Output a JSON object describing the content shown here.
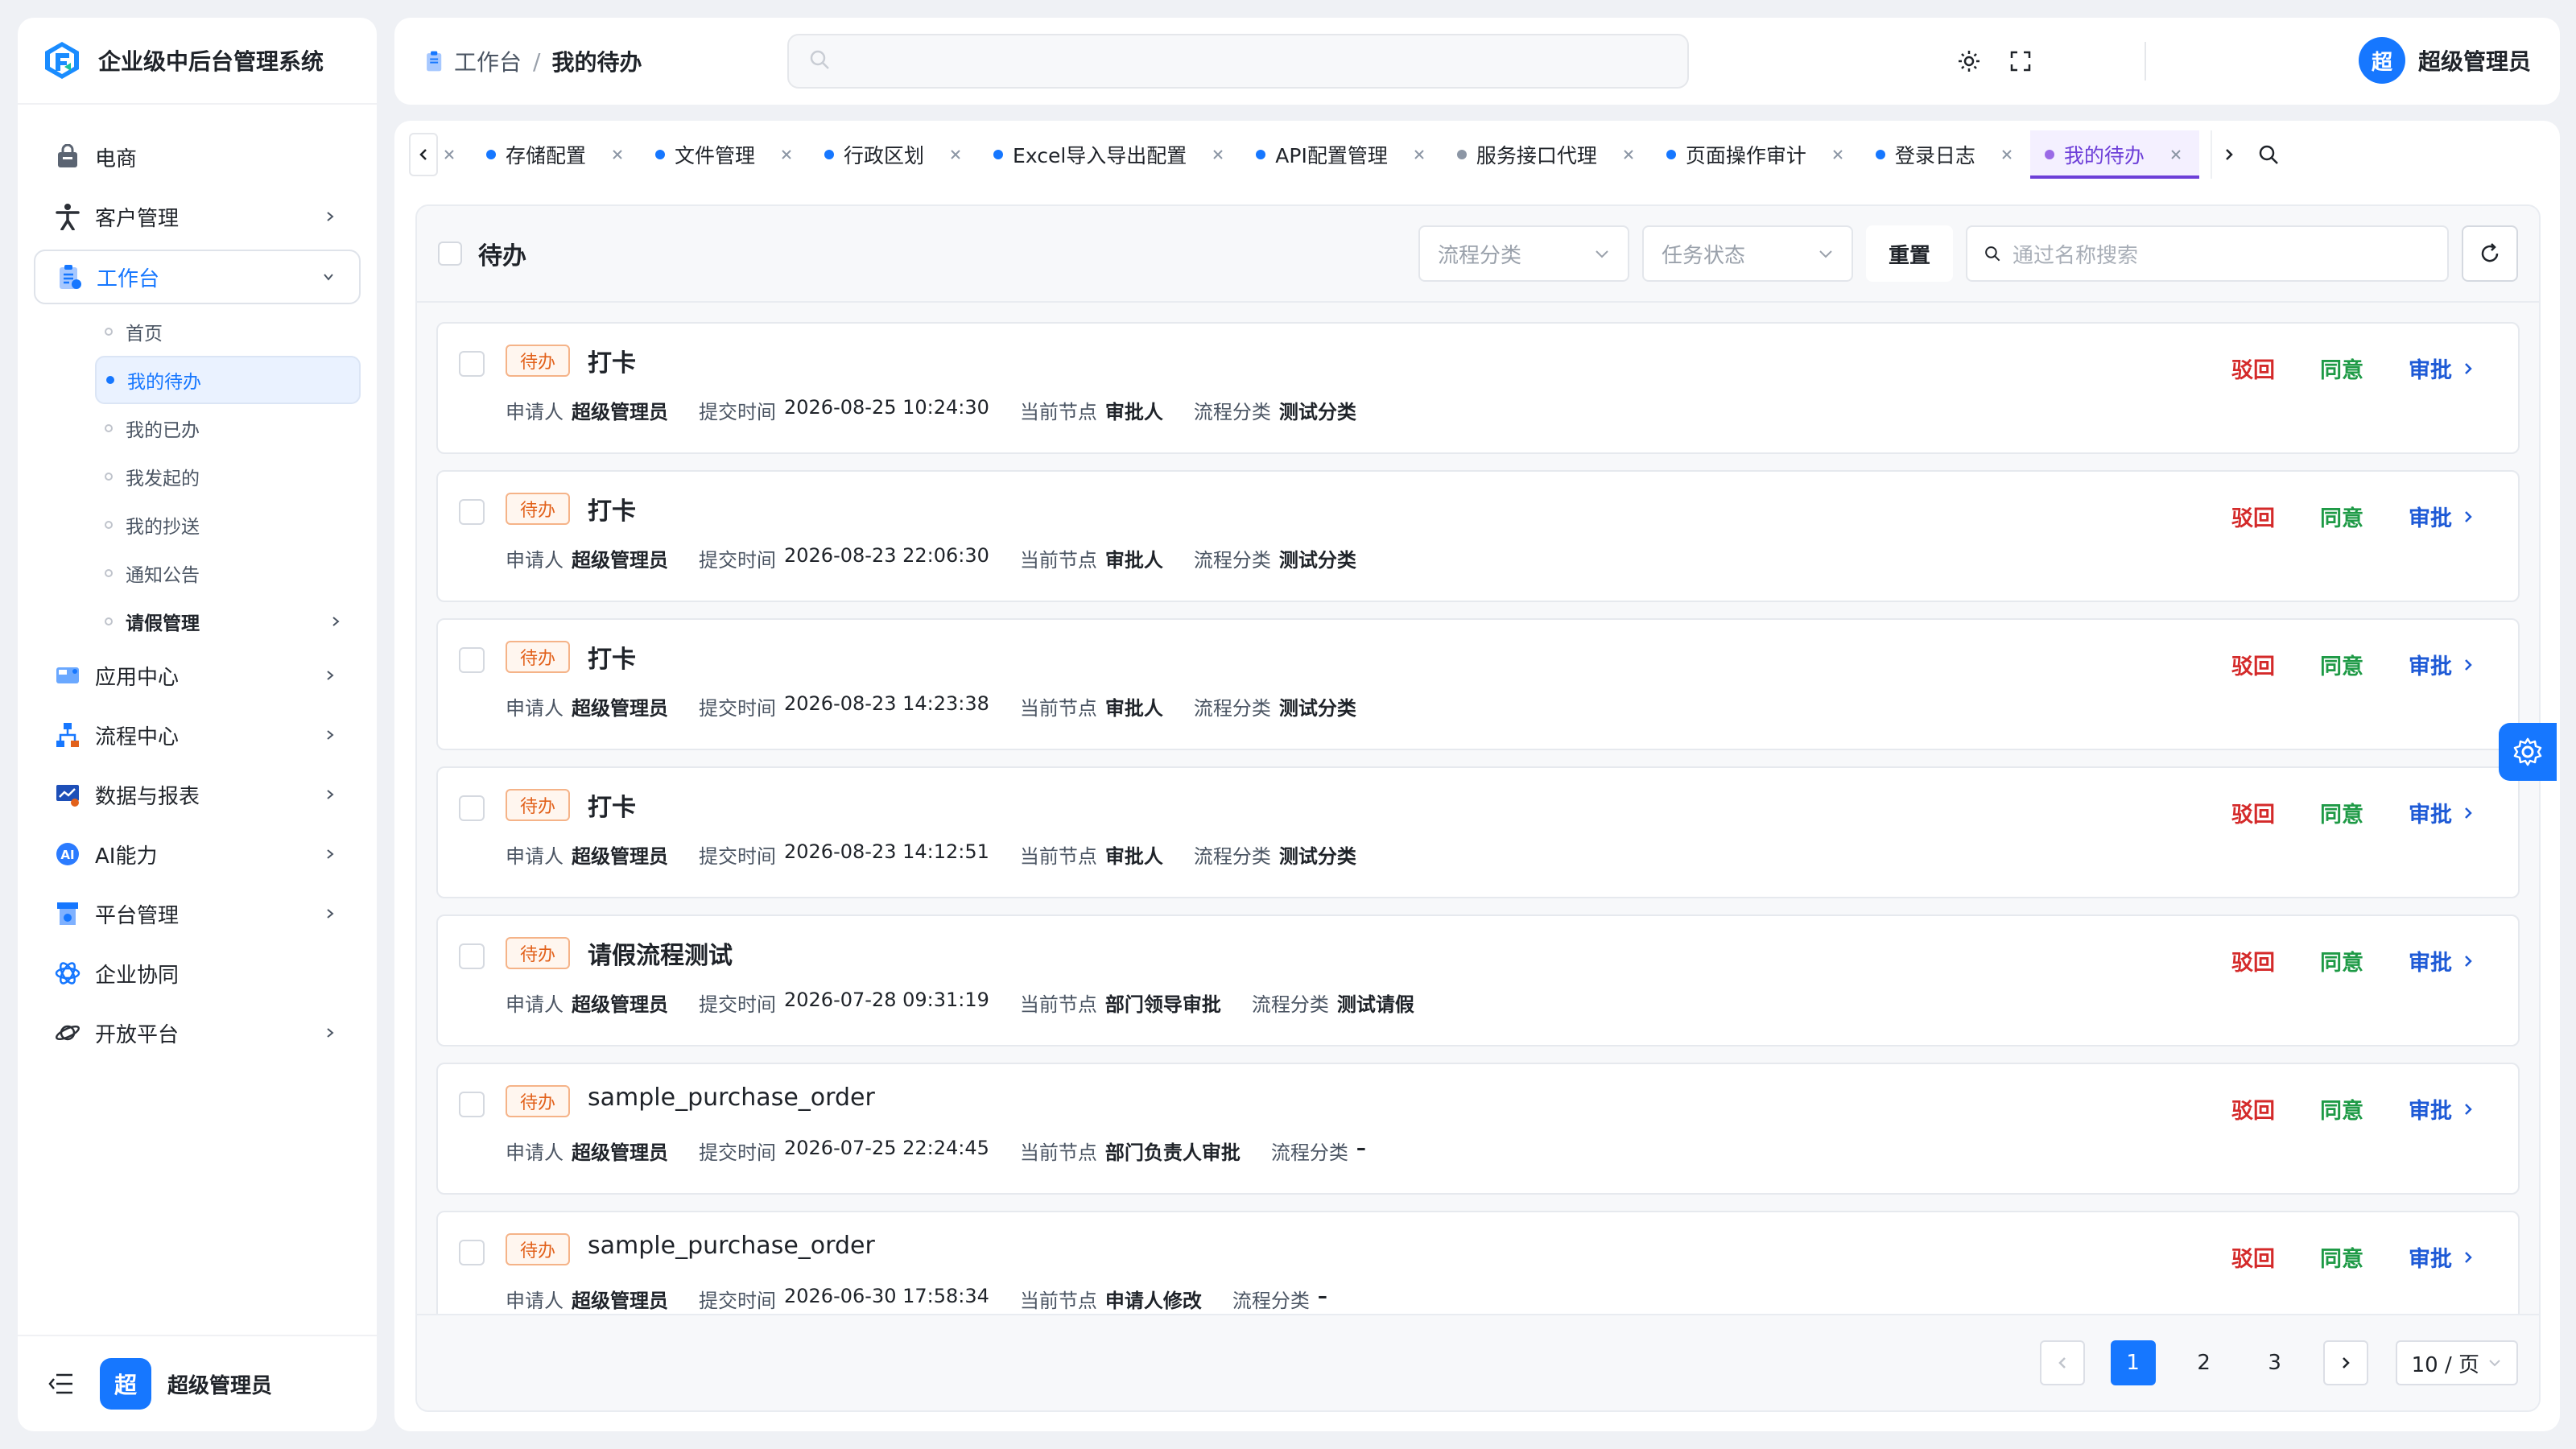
{
  "app": {
    "name": "企业级中后台管理系统"
  },
  "sidebar": {
    "items": [
      {
        "label": "电商",
        "icon": "bag-icon",
        "chevron": false
      },
      {
        "label": "客户管理",
        "icon": "person-icon",
        "chevron": true
      },
      {
        "label": "工作台",
        "icon": "clipboard-icon",
        "chevron": true,
        "active": true
      }
    ],
    "sub_items": [
      {
        "label": "首页"
      },
      {
        "label": "我的待办",
        "active": true
      },
      {
        "label": "我的已办"
      },
      {
        "label": "我发起的"
      },
      {
        "label": "我的抄送"
      },
      {
        "label": "通知公告"
      },
      {
        "label": "请假管理"
      }
    ],
    "more_items": [
      {
        "label": "应用中心"
      },
      {
        "label": "流程中心"
      },
      {
        "label": "数据与报表"
      },
      {
        "label": "AI能力"
      },
      {
        "label": "平台管理"
      },
      {
        "label": "企业协同"
      },
      {
        "label": "开放平台"
      }
    ],
    "footer": {
      "avatar_text": "超",
      "user": "超级管理员"
    }
  },
  "header": {
    "breadcrumb": [
      "工作台",
      "/",
      "我的待办"
    ],
    "user": {
      "avatar_text": "超",
      "name": "超级管理员"
    }
  },
  "tabs": [
    {
      "label": "存储配置"
    },
    {
      "label": "文件管理"
    },
    {
      "label": "行政区划"
    },
    {
      "label": "Excel导入导出配置"
    },
    {
      "label": "API配置管理"
    },
    {
      "label": "服务接口代理",
      "dot": "#8c96a5"
    },
    {
      "label": "页面操作审计"
    },
    {
      "label": "登录日志"
    },
    {
      "label": "我的待办",
      "active": true
    }
  ],
  "toolbar": {
    "title": "待办",
    "category_placeholder": "流程分类",
    "status_placeholder": "任务状态",
    "reset_label": "重置",
    "search_placeholder": "通过名称搜索"
  },
  "meta_labels": {
    "applicant": "申请人",
    "submit_time": "提交时间",
    "node": "当前节点",
    "category": "流程分类"
  },
  "actions": {
    "reject": "驳回",
    "agree": "同意",
    "approve": "审批"
  },
  "tasks": [
    {
      "tag": "待办",
      "title": "打卡",
      "applicant": "超级管理员",
      "time": "2026-08-25 10:24:30",
      "node": "审批人",
      "category": "测试分类"
    },
    {
      "tag": "待办",
      "title": "打卡",
      "applicant": "超级管理员",
      "time": "2026-08-23 22:06:30",
      "node": "审批人",
      "category": "测试分类"
    },
    {
      "tag": "待办",
      "title": "打卡",
      "applicant": "超级管理员",
      "time": "2026-08-23 14:23:38",
      "node": "审批人",
      "category": "测试分类"
    },
    {
      "tag": "待办",
      "title": "打卡",
      "applicant": "超级管理员",
      "time": "2026-08-23 14:12:51",
      "node": "审批人",
      "category": "测试分类"
    },
    {
      "tag": "待办",
      "title": "请假流程测试",
      "applicant": "超级管理员",
      "time": "2026-07-28 09:31:19",
      "node": "部门领导审批",
      "category": "测试请假"
    },
    {
      "tag": "待办",
      "title": "sample_purchase_order",
      "applicant": "超级管理员",
      "time": "2026-07-25 22:24:45",
      "node": "部门负责人审批",
      "category": "–"
    },
    {
      "tag": "待办",
      "title": "sample_purchase_order",
      "applicant": "超级管理员",
      "time": "2026-06-30 17:58:34",
      "node": "申请人修改",
      "category": "–"
    }
  ],
  "pagination": {
    "pages": [
      "1",
      "2",
      "3"
    ],
    "current": "1",
    "page_size": "10 / 页"
  },
  "colors": {
    "primary": "#1677ff",
    "reject": "#d42a2a",
    "agree": "#1e9a46",
    "approve": "#1e5ad6",
    "tag": "#e2611b",
    "active_tab": "#6d3fd8"
  }
}
